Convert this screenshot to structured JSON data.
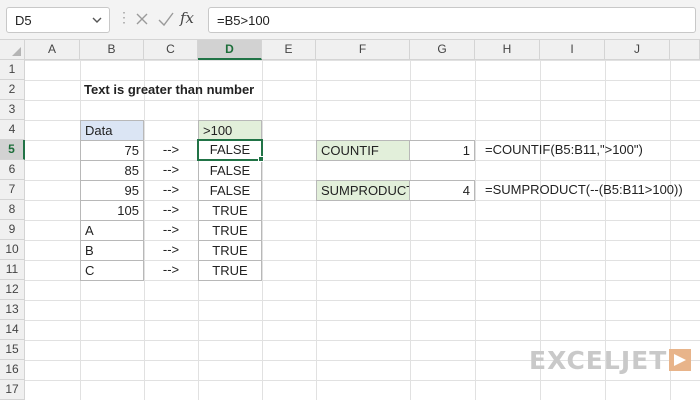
{
  "formula_bar": {
    "name_box": "D5",
    "formula": "=B5>100",
    "fx_label": "fx"
  },
  "columns": [
    "A",
    "B",
    "C",
    "D",
    "E",
    "F",
    "G",
    "H",
    "I",
    "J"
  ],
  "rows": [
    "1",
    "2",
    "3",
    "4",
    "5",
    "6",
    "7",
    "8",
    "9",
    "10",
    "11",
    "12",
    "13",
    "14",
    "15",
    "16",
    "17"
  ],
  "selected": {
    "column": "D",
    "row": "5"
  },
  "sheet": {
    "title": "Text is greater than number",
    "data_header": "Data",
    "data": [
      "75",
      "85",
      "95",
      "105",
      "A",
      "B",
      "C"
    ],
    "arrows": [
      "-->",
      "-->",
      "-->",
      "-->",
      "-->",
      "-->",
      "-->"
    ],
    "result_header": ">100",
    "results": [
      "FALSE",
      "FALSE",
      "FALSE",
      "TRUE",
      "TRUE",
      "TRUE",
      "TRUE"
    ],
    "countif": {
      "label": "COUNTIF",
      "value": "1",
      "formula": "=COUNTIF(B5:B11,\">100\")"
    },
    "sumproduct": {
      "label": "SUMPRODUCT",
      "value": "4",
      "formula": "=SUMPRODUCT(--(B5:B11>100))"
    }
  },
  "watermark": {
    "text": "EXCELJET"
  },
  "colors": {
    "accent": "#217346",
    "header_blue": "#dbe5f4",
    "header_green": "#e2efda"
  }
}
